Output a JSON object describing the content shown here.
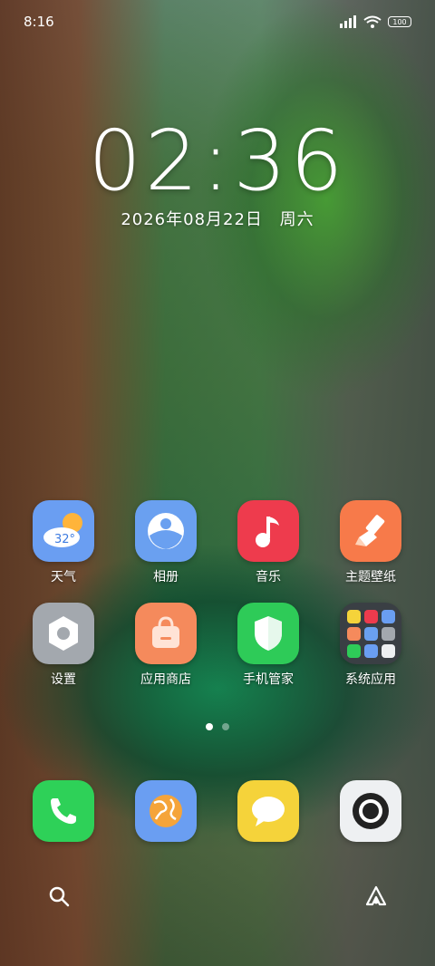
{
  "status": {
    "time": "8:16",
    "battery": "100"
  },
  "lock": {
    "time": "02:36",
    "date": "2026年08月22日",
    "weekday": "周六"
  },
  "apps": [
    {
      "name": "weather",
      "label": "天气",
      "temp": "32°"
    },
    {
      "name": "gallery",
      "label": "相册"
    },
    {
      "name": "music",
      "label": "音乐"
    },
    {
      "name": "themes",
      "label": "主题壁纸"
    },
    {
      "name": "settings",
      "label": "设置"
    },
    {
      "name": "app-store",
      "label": "应用商店"
    },
    {
      "name": "security",
      "label": "手机管家"
    },
    {
      "name": "system-apps",
      "label": "系统应用"
    }
  ],
  "dock": [
    "phone",
    "browser",
    "messages",
    "camera"
  ],
  "pages": {
    "count": 2,
    "current": 1
  },
  "colors": {
    "weather_bg": "#6a9ef2",
    "gallery_bg": "#6aa0f0",
    "music_bg": "#ee3b4d",
    "themes_bg": "#f77a4a",
    "settings_bg": "#a3a8ae",
    "store_bg": "#f58a5c",
    "security_bg": "#2ecb58",
    "folder_bg": "#3a3f44",
    "phone_bg": "#2ed158",
    "browser_bg": "#6a9ef2",
    "messages_bg": "#f5d33a",
    "camera_bg": "#eef0f2"
  }
}
